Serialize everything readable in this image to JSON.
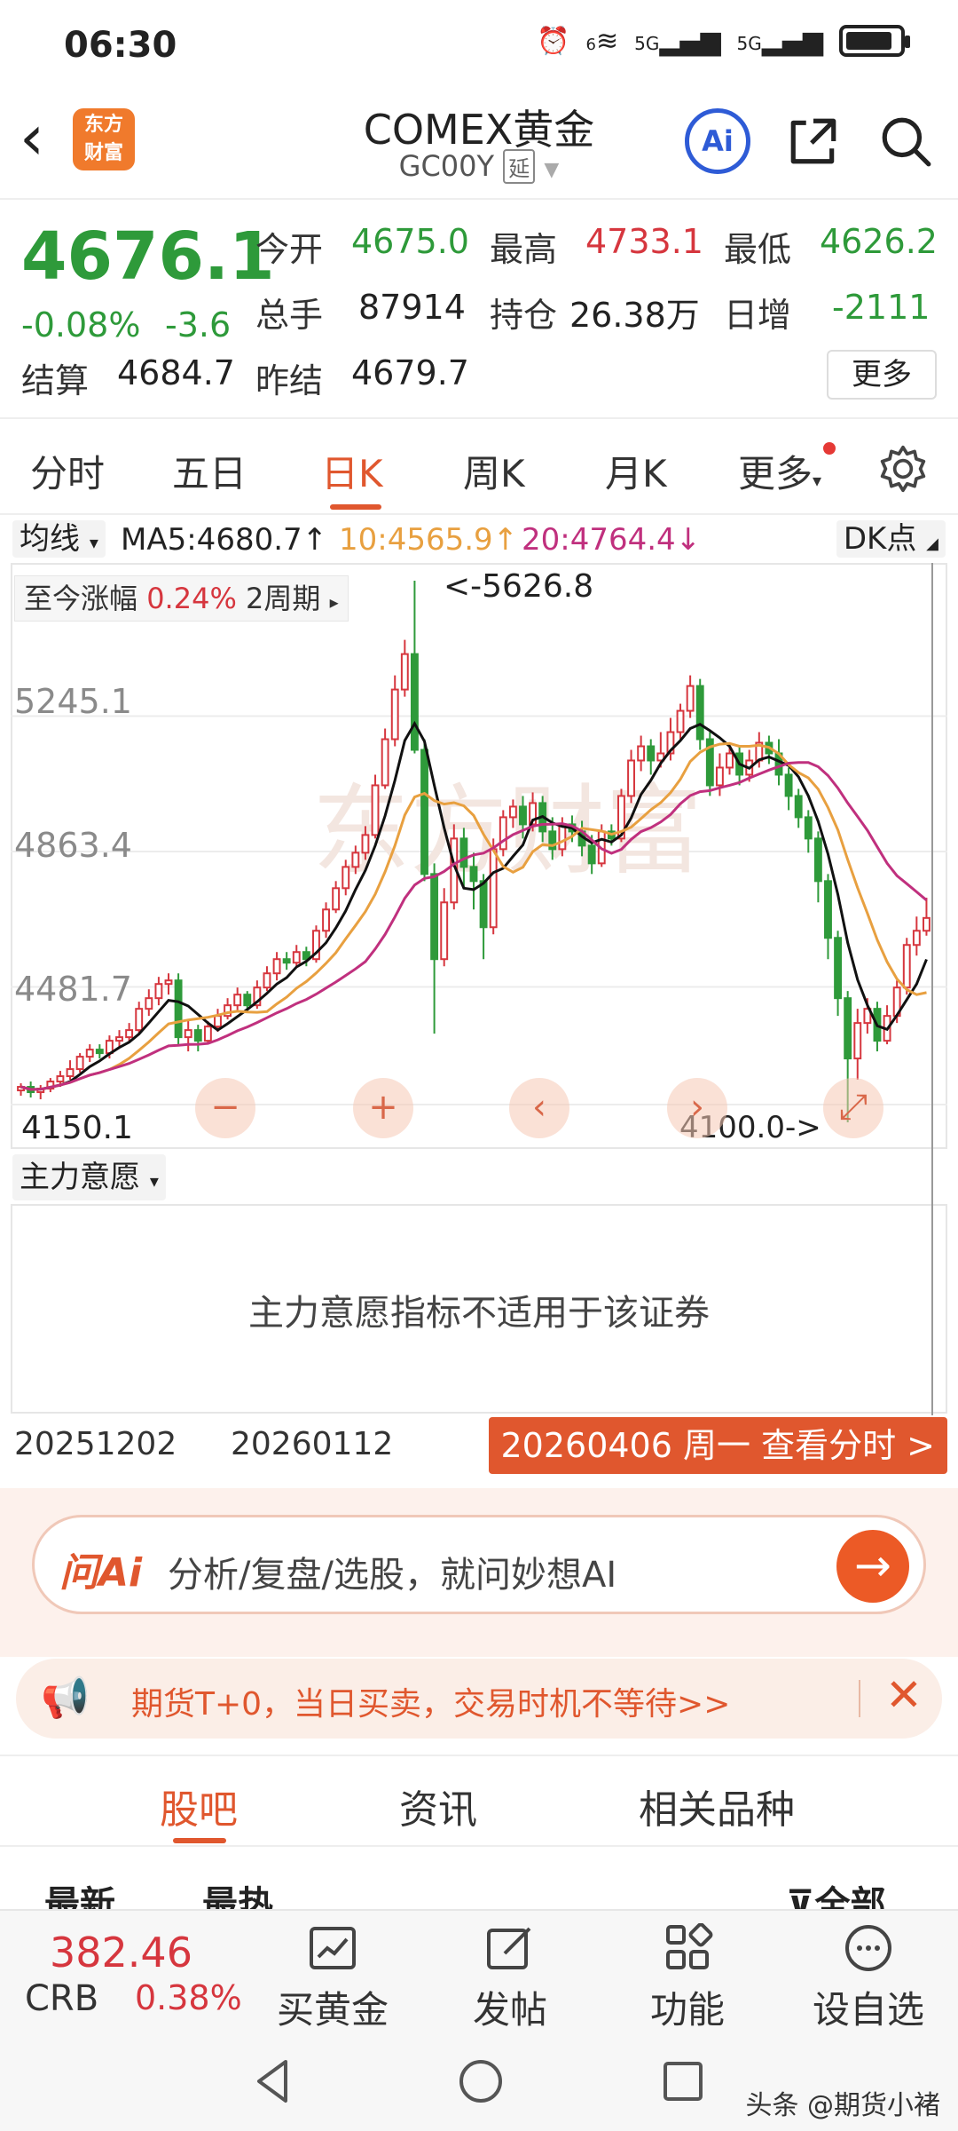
{
  "status": {
    "time": "06:30",
    "net1": "5G",
    "net2": "5G",
    "wifi_num": "6",
    "battery_level": 0.85
  },
  "header": {
    "title": "COMEX黄金",
    "code": "GC00Y",
    "tag": "延",
    "logo": "东方\n财富",
    "ai_label": "Ai"
  },
  "quote": {
    "price": "4676.1",
    "chg_pct": "-0.08%",
    "chg": "-3.6",
    "open_label": "今开",
    "open": "4675.0",
    "high_label": "最高",
    "high": "4733.1",
    "low_label": "最低",
    "low": "4626.2",
    "vol_label": "总手",
    "vol": "87914",
    "oi_label": "持仓",
    "oi": "26.38万",
    "inc_label": "日增",
    "inc": "-2111",
    "settle_label": "结算",
    "settle": "4684.7",
    "prev_label": "昨结",
    "prev": "4679.7",
    "more": "更多"
  },
  "period_tabs": [
    "分时",
    "五日",
    "日K",
    "周K",
    "月K",
    "更多"
  ],
  "ma_bar": {
    "select": "均线",
    "ma5": "MA5:4680.7↑",
    "ma10": "10:4565.9↑",
    "ma20": "20:4764.4↓",
    "dk": "DK点"
  },
  "chart_panel": {
    "period_label": "至今涨幅",
    "period_pct": "0.24%",
    "period_len": "2周期",
    "max_label": "<-5626.8",
    "min_label": "4100.0->",
    "nav": [
      "−",
      "+",
      "‹",
      "›",
      "⤢"
    ]
  },
  "chart_data": {
    "type": "candlestick",
    "y_ticks": [
      "5245.1",
      "4863.4",
      "4481.7",
      "4150.1"
    ],
    "ylim": [
      4100.0,
      5626.8
    ],
    "x_labels": [
      "20251202",
      "20260112"
    ],
    "high_marker": 5626.8,
    "low_marker": 4100.0,
    "series": [
      {
        "name": "MA5",
        "color": "#111111"
      },
      {
        "name": "10",
        "color": "#e8a040"
      },
      {
        "name": "20",
        "color": "#c0307e"
      }
    ],
    "candles": [
      [
        4190,
        4200,
        4175,
        4210
      ],
      [
        4200,
        4185,
        4170,
        4215
      ],
      [
        4185,
        4195,
        4165,
        4205
      ],
      [
        4195,
        4215,
        4185,
        4225
      ],
      [
        4215,
        4230,
        4200,
        4245
      ],
      [
        4230,
        4250,
        4220,
        4275
      ],
      [
        4250,
        4285,
        4240,
        4295
      ],
      [
        4285,
        4305,
        4270,
        4320
      ],
      [
        4305,
        4295,
        4280,
        4320
      ],
      [
        4295,
        4330,
        4280,
        4345
      ],
      [
        4330,
        4340,
        4310,
        4360
      ],
      [
        4340,
        4360,
        4325,
        4380
      ],
      [
        4360,
        4420,
        4350,
        4440
      ],
      [
        4420,
        4450,
        4400,
        4475
      ],
      [
        4450,
        4490,
        4430,
        4510
      ],
      [
        4490,
        4500,
        4460,
        4520
      ],
      [
        4500,
        4340,
        4320,
        4520
      ],
      [
        4340,
        4360,
        4300,
        4390
      ],
      [
        4360,
        4330,
        4300,
        4375
      ],
      [
        4330,
        4370,
        4320,
        4385
      ],
      [
        4370,
        4400,
        4355,
        4420
      ],
      [
        4400,
        4430,
        4390,
        4450
      ],
      [
        4430,
        4460,
        4410,
        4480
      ],
      [
        4460,
        4430,
        4410,
        4470
      ],
      [
        4430,
        4480,
        4420,
        4500
      ],
      [
        4480,
        4520,
        4470,
        4540
      ],
      [
        4520,
        4560,
        4500,
        4580
      ],
      [
        4560,
        4550,
        4530,
        4580
      ],
      [
        4550,
        4580,
        4540,
        4600
      ],
      [
        4580,
        4560,
        4540,
        4595
      ],
      [
        4560,
        4640,
        4550,
        4655
      ],
      [
        4640,
        4700,
        4620,
        4720
      ],
      [
        4700,
        4760,
        4690,
        4780
      ],
      [
        4760,
        4820,
        4740,
        4840
      ],
      [
        4820,
        4860,
        4800,
        4880
      ],
      [
        4860,
        4910,
        4840,
        4935
      ],
      [
        4910,
        5050,
        4900,
        5080
      ],
      [
        5050,
        5180,
        5040,
        5210
      ],
      [
        5180,
        5320,
        5160,
        5360
      ],
      [
        5320,
        5420,
        5300,
        5460
      ],
      [
        5420,
        5150,
        5140,
        5626.8
      ],
      [
        5150,
        4800,
        4780,
        5180
      ],
      [
        4800,
        4560,
        4350,
        4830
      ],
      [
        4560,
        4720,
        4540,
        4760
      ],
      [
        4720,
        4900,
        4700,
        4940
      ],
      [
        4900,
        4820,
        4760,
        4930
      ],
      [
        4820,
        4780,
        4700,
        4860
      ],
      [
        4780,
        4650,
        4560,
        4800
      ],
      [
        4650,
        4870,
        4630,
        4900
      ],
      [
        4870,
        4960,
        4850,
        4980
      ],
      [
        4960,
        4990,
        4930,
        5010
      ],
      [
        4990,
        4940,
        4900,
        5020
      ],
      [
        4940,
        5000,
        4920,
        5030
      ],
      [
        5000,
        4920,
        4890,
        5020
      ],
      [
        4920,
        4870,
        4840,
        4960
      ],
      [
        4870,
        4940,
        4850,
        4960
      ],
      [
        4940,
        4920,
        4890,
        4965
      ],
      [
        4920,
        4880,
        4850,
        4950
      ],
      [
        4880,
        4830,
        4800,
        4910
      ],
      [
        4830,
        4920,
        4820,
        4940
      ],
      [
        4920,
        4900,
        4880,
        4940
      ],
      [
        4900,
        5020,
        4890,
        5040
      ],
      [
        5020,
        5120,
        5000,
        5150
      ],
      [
        5120,
        5160,
        5090,
        5190
      ],
      [
        5160,
        5120,
        5080,
        5180
      ],
      [
        5120,
        5140,
        5100,
        5200
      ],
      [
        5140,
        5200,
        5120,
        5240
      ],
      [
        5200,
        5260,
        5180,
        5280
      ],
      [
        5260,
        5330,
        5240,
        5360
      ],
      [
        5330,
        5180,
        5150,
        5350
      ],
      [
        5180,
        5050,
        5020,
        5200
      ],
      [
        5050,
        5100,
        5020,
        5140
      ],
      [
        5100,
        5140,
        5080,
        5170
      ],
      [
        5140,
        5080,
        5050,
        5160
      ],
      [
        5080,
        5120,
        5060,
        5150
      ],
      [
        5120,
        5170,
        5100,
        5200
      ],
      [
        5170,
        5140,
        5110,
        5190
      ],
      [
        5140,
        5080,
        5050,
        5180
      ],
      [
        5080,
        5020,
        4980,
        5100
      ],
      [
        5020,
        4960,
        4930,
        5040
      ],
      [
        4960,
        4900,
        4860,
        4980
      ],
      [
        4900,
        4780,
        4720,
        4920
      ],
      [
        4780,
        4620,
        4560,
        4800
      ],
      [
        4620,
        4450,
        4400,
        4640
      ],
      [
        4450,
        4280,
        4100,
        4470
      ],
      [
        4280,
        4380,
        4220,
        4420
      ],
      [
        4380,
        4420,
        4350,
        4450
      ],
      [
        4420,
        4330,
        4300,
        4440
      ],
      [
        4330,
        4400,
        4320,
        4430
      ],
      [
        4400,
        4480,
        4380,
        4500
      ],
      [
        4480,
        4600,
        4460,
        4620
      ],
      [
        4600,
        4640,
        4570,
        4680
      ],
      [
        4640,
        4676.1,
        4626.2,
        4733.1
      ]
    ]
  },
  "indicator": {
    "select": "主力意愿",
    "message": "主力意愿指标不适用于该证券"
  },
  "date_badge": "20260406 周一 查看分时 >",
  "ai_bar": {
    "logo": "问Ai",
    "placeholder": "分析/复盘/选股，就问妙想AI"
  },
  "promo": {
    "text": "期货T+0，当日买卖，交易时机不等待>>"
  },
  "content_tabs": [
    "股吧",
    "资讯",
    "相关品种"
  ],
  "sort": {
    "latest": "最新",
    "hot": "最热",
    "filter": "全部"
  },
  "bottom": {
    "crb_value": "382.46",
    "crb_name": "CRB",
    "crb_pct": "0.38%",
    "actions": [
      "买黄金",
      "发帖",
      "功能",
      "设自选"
    ]
  },
  "watermark": "头条 @期货小褚"
}
